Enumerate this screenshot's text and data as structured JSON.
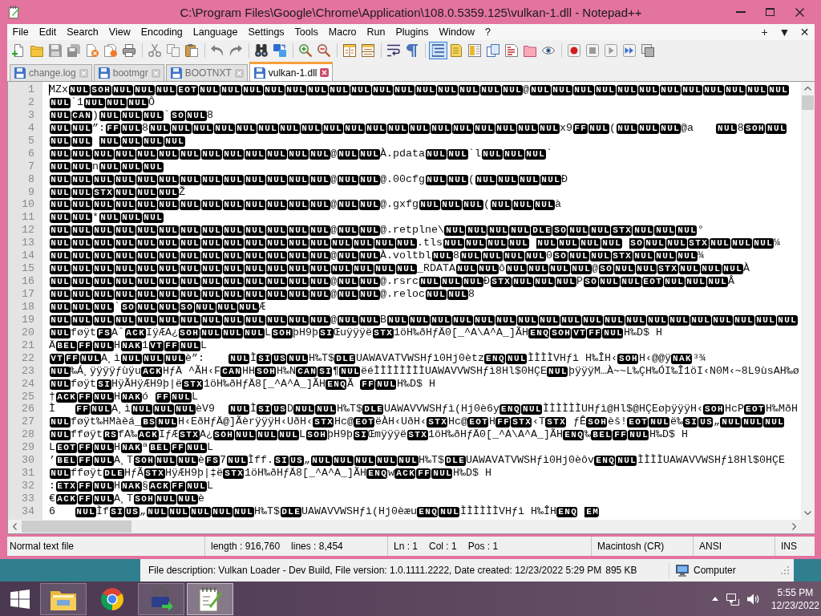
{
  "window": {
    "title": "C:\\Program Files\\Google\\Chrome\\Application\\108.0.5359.125\\vulkan-1.dll - Notepad++"
  },
  "menu": {
    "items": [
      "File",
      "Edit",
      "Search",
      "View",
      "Encoding",
      "Language",
      "Settings",
      "Tools",
      "Macro",
      "Run",
      "Plugins",
      "Window",
      "?"
    ],
    "right": [
      "+",
      "▼",
      "✕"
    ]
  },
  "toolbar": [
    {
      "buttons": [
        {
          "pressed": false
        },
        {
          "pressed": false
        },
        {
          "pressed": false
        },
        {
          "pressed": false
        },
        {
          "pressed": false
        },
        {
          "pressed": false
        },
        {
          "pressed": false
        }
      ]
    },
    {
      "buttons": [
        {
          "pressed": false
        },
        {
          "pressed": false
        },
        {
          "pressed": false
        }
      ]
    },
    {
      "buttons": [
        {
          "pressed": false
        },
        {
          "pressed": false
        }
      ]
    },
    {
      "buttons": [
        {
          "pressed": false
        },
        {
          "pressed": false
        }
      ]
    },
    {
      "buttons": [
        {
          "pressed": false
        },
        {
          "pressed": false
        }
      ]
    },
    {
      "buttons": [
        {
          "pressed": false
        },
        {
          "pressed": false
        }
      ]
    },
    {
      "buttons": [
        {
          "pressed": false
        },
        {
          "pressed": false
        }
      ]
    },
    {
      "buttons": [
        {
          "pressed": true
        },
        {
          "pressed": false
        },
        {
          "pressed": false
        },
        {
          "pressed": false
        },
        {
          "pressed": false
        },
        {
          "pressed": false
        },
        {
          "pressed": false
        }
      ]
    },
    {
      "buttons": [
        {
          "pressed": false
        },
        {
          "pressed": false
        },
        {
          "pressed": false
        },
        {
          "pressed": false
        },
        {
          "pressed": false
        }
      ]
    }
  ],
  "tabs": [
    {
      "label": "change.log",
      "selected": false
    },
    {
      "label": "bootmgr",
      "selected": false
    },
    {
      "label": "BOOTNXT",
      "selected": false
    },
    {
      "label": "vulkan-1.dll",
      "selected": true
    }
  ],
  "editor": {
    "lines": [
      {
        "number": "1",
        "runs": [
          "MZx",
          {
            "ctl": "NUL"
          },
          {
            "ctl": "SOH"
          },
          {
            "ctl": "NUL"
          },
          {
            "ctl": "NUL"
          },
          {
            "ctl": "NUL"
          },
          {
            "ctl": "EOT"
          },
          {
            "ctl": "NUL"
          },
          {
            "ctl": "NUL"
          },
          {
            "ctl": "NUL"
          },
          {
            "ctl": "NUL"
          },
          {
            "ctl": "NUL"
          },
          {
            "ctl": "NUL"
          },
          {
            "ctl": "NUL"
          },
          {
            "ctl": "NUL"
          },
          {
            "ctl": "NUL"
          },
          {
            "ctl": "NUL"
          },
          {
            "ctl": "NUL"
          },
          {
            "ctl": "NUL"
          },
          {
            "ctl": "NUL"
          },
          {
            "ctl": "NUL"
          },
          {
            "ctl": "NUL"
          },
          "@",
          {
            "ctl": "NUL"
          },
          {
            "ctl": "NUL"
          },
          {
            "ctl": "NUL"
          },
          {
            "ctl": "NUL"
          },
          {
            "ctl": "NUL"
          },
          {
            "ctl": "NUL"
          },
          {
            "ctl": "NUL"
          },
          {
            "ctl": "NUL"
          },
          {
            "ctl": "NUL"
          },
          {
            "ctl": "NUL"
          },
          {
            "ctl": "NUL"
          },
          {
            "ctl": "NUL"
          }
        ]
      },
      {
        "number": "2",
        "runs": [
          {
            "ctl": "NUL"
          },
          "`1",
          {
            "ctl": "NUL"
          },
          {
            "ctl": "NUL"
          },
          {
            "ctl": "NUL"
          },
          "Ô"
        ]
      },
      {
        "number": "3",
        "runs": [
          {
            "ctl": "NUL"
          },
          {
            "ctl": "CAN"
          },
          ")",
          {
            "ctl": "NUL"
          },
          {
            "ctl": "NUL"
          },
          {
            "ctl": "NUL"
          },
          "`",
          {
            "ctl": "SO"
          },
          {
            "ctl": "NUL"
          },
          "8"
        ]
      },
      {
        "number": "4",
        "runs": [
          {
            "ctl": "NUL"
          },
          {
            "ctl": "NUL"
          },
          "”:",
          {
            "ctl": "FF"
          },
          {
            "ctl": "NUL"
          },
          "8",
          {
            "ctl": "NUL"
          },
          {
            "ctl": "NUL"
          },
          {
            "ctl": "NUL"
          },
          {
            "ctl": "NUL"
          },
          {
            "ctl": "NUL"
          },
          {
            "ctl": "NUL"
          },
          {
            "ctl": "NUL"
          },
          {
            "ctl": "NUL"
          },
          {
            "ctl": "NUL"
          },
          {
            "ctl": "NUL"
          },
          {
            "ctl": "NUL"
          },
          {
            "ctl": "NUL"
          },
          {
            "ctl": "NUL"
          },
          {
            "ctl": "NUL"
          },
          {
            "ctl": "NUL"
          },
          {
            "ctl": "NUL"
          },
          {
            "ctl": "NUL"
          },
          {
            "ctl": "NUL"
          },
          {
            "ctl": "NUL"
          },
          "x9",
          {
            "ctl": "FF"
          },
          {
            "ctl": "NUL"
          },
          "(",
          {
            "ctl": "NUL"
          },
          {
            "ctl": "NUL"
          },
          {
            "ctl": "NUL"
          },
          "@a\t",
          {
            "ctl": "NUL"
          },
          "8",
          {
            "ctl": "SOH"
          },
          {
            "ctl": "NUL"
          }
        ]
      },
      {
        "number": "5",
        "runs": [
          {
            "ctl": "NUL"
          },
          {
            "ctl": "NUL"
          },
          {
            "ctl": "NUL",
            "spaced": true
          },
          {
            "ctl": "NUL"
          },
          {
            "ctl": "NUL"
          },
          {
            "ctl": "NUL"
          }
        ]
      },
      {
        "number": "6",
        "runs": [
          {
            "ctl": "NUL"
          },
          {
            "ctl": "NUL"
          },
          {
            "ctl": "NUL"
          },
          {
            "ctl": "NUL"
          },
          {
            "ctl": "NUL"
          },
          {
            "ctl": "NUL"
          },
          {
            "ctl": "NUL"
          },
          {
            "ctl": "NUL"
          },
          {
            "ctl": "NUL"
          },
          {
            "ctl": "NUL"
          },
          {
            "ctl": "NUL"
          },
          {
            "ctl": "NUL"
          },
          {
            "ctl": "NUL"
          },
          "@",
          {
            "ctl": "NUL"
          },
          {
            "ctl": "NUL"
          },
          "À.pdata",
          {
            "ctl": "NUL"
          },
          {
            "ctl": "NUL"
          },
          "`l",
          {
            "ctl": "NUL"
          },
          {
            "ctl": "NUL"
          },
          {
            "ctl": "NUL"
          },
          "`"
        ]
      },
      {
        "number": "7",
        "runs": [
          {
            "ctl": "NUL"
          },
          {
            "ctl": "NUL"
          },
          "n",
          {
            "ctl": "NUL"
          },
          {
            "ctl": "NUL"
          },
          {
            "ctl": "NUL"
          }
        ]
      },
      {
        "number": "8",
        "runs": [
          {
            "ctl": "NUL"
          },
          {
            "ctl": "NUL"
          },
          {
            "ctl": "NUL"
          },
          {
            "ctl": "NUL"
          },
          {
            "ctl": "NUL"
          },
          {
            "ctl": "NUL"
          },
          {
            "ctl": "NUL"
          },
          {
            "ctl": "NUL"
          },
          {
            "ctl": "NUL"
          },
          {
            "ctl": "NUL"
          },
          {
            "ctl": "NUL"
          },
          {
            "ctl": "NUL"
          },
          {
            "ctl": "NUL"
          },
          "@",
          {
            "ctl": "NUL"
          },
          {
            "ctl": "NUL"
          },
          "@.00cfg",
          {
            "ctl": "NUL"
          },
          {
            "ctl": "NUL"
          },
          "(",
          {
            "ctl": "NUL"
          },
          {
            "ctl": "NUL"
          },
          {
            "ctl": "NUL"
          },
          {
            "ctl": "NUL"
          },
          "Ð"
        ]
      },
      {
        "number": "9",
        "runs": [
          {
            "ctl": "NUL"
          },
          {
            "ctl": "NUL"
          },
          {
            "ctl": "STX"
          },
          {
            "ctl": "NUL"
          },
          {
            "ctl": "NUL"
          },
          {
            "ctl": "NUL"
          },
          "Ž"
        ]
      },
      {
        "number": "10",
        "runs": [
          {
            "ctl": "NUL"
          },
          {
            "ctl": "NUL"
          },
          {
            "ctl": "NUL"
          },
          {
            "ctl": "NUL"
          },
          {
            "ctl": "NUL"
          },
          {
            "ctl": "NUL"
          },
          {
            "ctl": "NUL"
          },
          {
            "ctl": "NUL"
          },
          {
            "ctl": "NUL"
          },
          {
            "ctl": "NUL"
          },
          {
            "ctl": "NUL"
          },
          {
            "ctl": "NUL"
          },
          {
            "ctl": "NUL"
          },
          "@",
          {
            "ctl": "NUL"
          },
          {
            "ctl": "NUL"
          },
          "@.gxfg",
          {
            "ctl": "NUL"
          },
          {
            "ctl": "NUL"
          },
          {
            "ctl": "NUL"
          },
          "(",
          {
            "ctl": "NUL"
          },
          {
            "ctl": "NUL"
          },
          {
            "ctl": "NUL"
          },
          "à"
        ]
      },
      {
        "number": "11",
        "runs": [
          {
            "ctl": "NUL"
          },
          {
            "ctl": "NUL"
          },
          "*",
          {
            "ctl": "NUL"
          },
          {
            "ctl": "NUL"
          },
          {
            "ctl": "NUL"
          }
        ]
      },
      {
        "number": "12",
        "runs": [
          {
            "ctl": "NUL"
          },
          {
            "ctl": "NUL"
          },
          {
            "ctl": "NUL"
          },
          {
            "ctl": "NUL"
          },
          {
            "ctl": "NUL"
          },
          {
            "ctl": "NUL"
          },
          {
            "ctl": "NUL"
          },
          {
            "ctl": "NUL"
          },
          {
            "ctl": "NUL"
          },
          {
            "ctl": "NUL"
          },
          {
            "ctl": "NUL"
          },
          {
            "ctl": "NUL"
          },
          {
            "ctl": "NUL"
          },
          "@",
          {
            "ctl": "NUL"
          },
          {
            "ctl": "NUL"
          },
          "@.retplne\\",
          {
            "ctl": "NUL"
          },
          {
            "ctl": "NUL"
          },
          {
            "ctl": "NUL"
          },
          {
            "ctl": "NUL"
          },
          {
            "ctl": "DLE"
          },
          {
            "ctl": "SO"
          },
          {
            "ctl": "NUL"
          },
          {
            "ctl": "NUL"
          },
          {
            "ctl": "STX"
          },
          {
            "ctl": "NUL"
          },
          {
            "ctl": "NUL"
          },
          {
            "ctl": "NUL"
          },
          "°"
        ]
      },
      {
        "number": "13",
        "runs": [
          {
            "ctl": "NUL"
          },
          {
            "ctl": "NUL"
          },
          {
            "ctl": "NUL"
          },
          {
            "ctl": "NUL"
          },
          {
            "ctl": "NUL"
          },
          {
            "ctl": "NUL"
          },
          {
            "ctl": "NUL"
          },
          {
            "ctl": "NUL"
          },
          {
            "ctl": "NUL"
          },
          {
            "ctl": "NUL"
          },
          {
            "ctl": "NUL"
          },
          {
            "ctl": "NUL"
          },
          {
            "ctl": "NUL"
          },
          {
            "ctl": "NUL"
          },
          {
            "ctl": "NUL"
          },
          {
            "ctl": "NUL"
          },
          {
            "ctl": "NUL"
          },
          ".tls",
          {
            "ctl": "NUL"
          },
          {
            "ctl": "NUL"
          },
          {
            "ctl": "NUL"
          },
          {
            "ctl": "NUL"
          },
          {
            "ctl": "NUL",
            "spaced": true
          },
          {
            "ctl": "NUL"
          },
          {
            "ctl": "NUL"
          },
          {
            "ctl": "NUL"
          },
          {
            "ctl": "SO",
            "spaced": true
          },
          {
            "ctl": "NUL"
          },
          {
            "ctl": "NUL"
          },
          {
            "ctl": "STX"
          },
          {
            "ctl": "NUL"
          },
          {
            "ctl": "NUL"
          },
          {
            "ctl": "NUL"
          },
          "¼"
        ]
      },
      {
        "number": "14",
        "runs": [
          {
            "ctl": "NUL"
          },
          {
            "ctl": "NUL"
          },
          {
            "ctl": "NUL"
          },
          {
            "ctl": "NUL"
          },
          {
            "ctl": "NUL"
          },
          {
            "ctl": "NUL"
          },
          {
            "ctl": "NUL"
          },
          {
            "ctl": "NUL"
          },
          {
            "ctl": "NUL"
          },
          {
            "ctl": "NUL"
          },
          {
            "ctl": "NUL"
          },
          {
            "ctl": "NUL"
          },
          {
            "ctl": "NUL"
          },
          "@",
          {
            "ctl": "NUL"
          },
          {
            "ctl": "NUL"
          },
          "À.voltbl",
          {
            "ctl": "NUL"
          },
          "8",
          {
            "ctl": "NUL"
          },
          {
            "ctl": "NUL"
          },
          {
            "ctl": "NUL"
          },
          {
            "ctl": "NUL"
          },
          "0",
          {
            "ctl": "SO"
          },
          {
            "ctl": "NUL"
          },
          {
            "ctl": "NUL"
          },
          {
            "ctl": "STX"
          },
          {
            "ctl": "NUL"
          },
          {
            "ctl": "NUL"
          },
          {
            "ctl": "NUL"
          },
          "¾"
        ]
      },
      {
        "number": "15",
        "runs": [
          {
            "ctl": "NUL"
          },
          {
            "ctl": "NUL"
          },
          {
            "ctl": "NUL"
          },
          {
            "ctl": "NUL"
          },
          {
            "ctl": "NUL"
          },
          {
            "ctl": "NUL"
          },
          {
            "ctl": "NUL"
          },
          {
            "ctl": "NUL"
          },
          {
            "ctl": "NUL"
          },
          {
            "ctl": "NUL"
          },
          {
            "ctl": "NUL"
          },
          {
            "ctl": "NUL"
          },
          {
            "ctl": "NUL"
          },
          {
            "ctl": "NUL"
          },
          {
            "ctl": "NUL"
          },
          {
            "ctl": "NUL"
          },
          {
            "ctl": "NUL"
          },
          "_RDATA",
          {
            "ctl": "NUL"
          },
          {
            "ctl": "NUL"
          },
          "ô",
          {
            "ctl": "NUL"
          },
          {
            "ctl": "NUL"
          },
          {
            "ctl": "NUL"
          },
          {
            "ctl": "NUL"
          },
          "@",
          {
            "ctl": "SO"
          },
          {
            "ctl": "NUL"
          },
          {
            "ctl": "NUL"
          },
          {
            "ctl": "STX"
          },
          {
            "ctl": "NUL"
          },
          {
            "ctl": "NUL"
          },
          {
            "ctl": "NUL"
          },
          "À"
        ]
      },
      {
        "number": "16",
        "runs": [
          {
            "ctl": "NUL"
          },
          {
            "ctl": "NUL"
          },
          {
            "ctl": "NUL"
          },
          {
            "ctl": "NUL"
          },
          {
            "ctl": "NUL"
          },
          {
            "ctl": "NUL"
          },
          {
            "ctl": "NUL"
          },
          {
            "ctl": "NUL"
          },
          {
            "ctl": "NUL"
          },
          {
            "ctl": "NUL"
          },
          {
            "ctl": "NUL"
          },
          {
            "ctl": "NUL"
          },
          {
            "ctl": "NUL"
          },
          "@",
          {
            "ctl": "NUL"
          },
          {
            "ctl": "NUL"
          },
          "@.rsrc",
          {
            "ctl": "NUL"
          },
          {
            "ctl": "NUL"
          },
          {
            "ctl": "NUL"
          },
          "Ð",
          {
            "ctl": "STX"
          },
          {
            "ctl": "NUL"
          },
          {
            "ctl": "NUL"
          },
          {
            "ctl": "NUL"
          },
          "P",
          {
            "ctl": "SO"
          },
          {
            "ctl": "NUL"
          },
          {
            "ctl": "NUL"
          },
          {
            "ctl": "EOT"
          },
          {
            "ctl": "NUL"
          },
          {
            "ctl": "NUL"
          },
          {
            "ctl": "NUL"
          },
          "Â"
        ]
      },
      {
        "number": "17",
        "runs": [
          {
            "ctl": "NUL"
          },
          {
            "ctl": "NUL"
          },
          {
            "ctl": "NUL"
          },
          {
            "ctl": "NUL"
          },
          {
            "ctl": "NUL"
          },
          {
            "ctl": "NUL"
          },
          {
            "ctl": "NUL"
          },
          {
            "ctl": "NUL"
          },
          {
            "ctl": "NUL"
          },
          {
            "ctl": "NUL"
          },
          {
            "ctl": "NUL"
          },
          {
            "ctl": "NUL"
          },
          {
            "ctl": "NUL"
          },
          "@",
          {
            "ctl": "NUL"
          },
          {
            "ctl": "NUL"
          },
          "@.reloc",
          {
            "ctl": "NUL"
          },
          {
            "ctl": "NUL"
          },
          "8"
        ]
      },
      {
        "number": "18",
        "runs": [
          {
            "ctl": "NUL"
          },
          {
            "ctl": "NUL"
          },
          {
            "ctl": "NUL"
          },
          "`",
          {
            "ctl": "SO"
          },
          {
            "ctl": "NUL"
          },
          {
            "ctl": "NUL"
          },
          {
            "ctl": "SO"
          },
          {
            "ctl": "NUL"
          },
          {
            "ctl": "NUL"
          },
          {
            "ctl": "NUL"
          },
          "Æ"
        ]
      },
      {
        "number": "19",
        "runs": [
          {
            "ctl": "NUL"
          },
          {
            "ctl": "NUL"
          },
          {
            "ctl": "NUL"
          },
          {
            "ctl": "NUL"
          },
          {
            "ctl": "NUL"
          },
          {
            "ctl": "NUL"
          },
          {
            "ctl": "NUL"
          },
          {
            "ctl": "NUL"
          },
          {
            "ctl": "NUL"
          },
          {
            "ctl": "NUL"
          },
          {
            "ctl": "NUL"
          },
          {
            "ctl": "NUL"
          },
          {
            "ctl": "NUL"
          },
          "@",
          {
            "ctl": "NUL"
          },
          {
            "ctl": "NUL"
          },
          "B",
          {
            "ctl": "NUL"
          },
          {
            "ctl": "NUL"
          },
          {
            "ctl": "NUL"
          },
          {
            "ctl": "NUL"
          },
          {
            "ctl": "NUL"
          },
          {
            "ctl": "NUL"
          },
          {
            "ctl": "NUL"
          },
          {
            "ctl": "NUL"
          },
          {
            "ctl": "NUL"
          },
          {
            "ctl": "NUL"
          },
          {
            "ctl": "NUL"
          },
          {
            "ctl": "NUL"
          },
          {
            "ctl": "NUL"
          },
          {
            "ctl": "NUL"
          },
          {
            "ctl": "NUL"
          },
          {
            "ctl": "NUL"
          },
          {
            "ctl": "NUL"
          },
          {
            "ctl": "NUL"
          },
          {
            "ctl": "NUL"
          }
        ]
      },
      {
        "number": "20",
        "runs": [
          {
            "ctl": "NUL"
          },
          "føÿt",
          {
            "ctl": "FS"
          },
          "Aˆ",
          {
            "ctl": "ACK"
          },
          "IÿÆA¿",
          {
            "ctl": "SOH"
          },
          {
            "ctl": "NUL"
          },
          {
            "ctl": "NUL"
          },
          {
            "ctl": "NUL"
          },
          "L",
          {
            "ctl": "SOH"
          },
          "þH9þ",
          {
            "ctl": "SI"
          },
          "Œuÿÿÿë",
          {
            "ctl": "STX"
          },
          "1öH‰ðHƒÄ0[_^A\\A^A_]ÃH",
          {
            "ctl": "ENQ"
          },
          {
            "ctl": "SOH"
          },
          {
            "ctl": "VT"
          },
          {
            "ctl": "FF"
          },
          {
            "ctl": "NUL"
          },
          "H‰D$ H"
        ]
      },
      {
        "number": "21",
        "runs": [
          "Ä",
          {
            "ctl": "BEL"
          },
          {
            "ctl": "FF"
          },
          {
            "ctl": "NUL"
          },
          "H",
          {
            "ctl": "NAK"
          },
          "1",
          {
            "ctl": "VT"
          },
          {
            "ctl": "FF"
          },
          {
            "ctl": "NUL"
          },
          "L"
        ]
      },
      {
        "number": "22",
        "runs": [
          {
            "ctl": "VT"
          },
          {
            "ctl": "FF"
          },
          {
            "ctl": "NUL"
          },
          "A¸ì",
          {
            "ctl": "NUL"
          },
          {
            "ctl": "NUL"
          },
          {
            "ctl": "NUL"
          },
          "è”:\t",
          {
            "ctl": "NUL"
          },
          "Ì",
          {
            "ctl": "SI"
          },
          {
            "ctl": "US"
          },
          {
            "ctl": "NUL"
          },
          "H‰T$",
          {
            "ctl": "DLE"
          },
          "UAWAVATVWSHƒì0Hj0ètz",
          {
            "ctl": "ENQ"
          },
          {
            "ctl": "NUL"
          },
          "ÌÌÌÌVHƒì H‰ÎH‹",
          {
            "ctl": "SOH"
          },
          "H‹@@ÿ",
          {
            "ctl": "NAK"
          },
          "³¾"
        ]
      },
      {
        "number": "23",
        "runs": [
          {
            "ctl": "NUL"
          },
          "‰Á¸ÿÿÿÿƒùÿu",
          {
            "ctl": "ACK"
          },
          "HƒÄ ^ÃH‹F",
          {
            "ctl": "CAN"
          },
          "HH",
          {
            "ctl": "SOH"
          },
          "H‰N",
          {
            "ctl": "CAN"
          },
          {
            "ctl": "SI"
          },
          "¶",
          {
            "ctl": "NUL"
          },
          "ëéÌÌÌÌÌÌÌÌUAWAVVWSHƒì8Hl$0HÇE",
          {
            "ctl": "NUL"
          },
          "þÿÿÿM…À~~L‰ÇH‰ÓI‰Î1öI‹N0M‹~8L9ùsAH‰ø"
        ]
      },
      {
        "number": "24",
        "runs": [
          {
            "ctl": "NUL"
          },
          "føÿt",
          {
            "ctl": "SI"
          },
          "HÿÃHÿÆH9þ|ë",
          {
            "ctl": "STX"
          },
          "1öH‰ðHƒÄ8[_^A^A_]ÃH",
          {
            "ctl": "ENQ"
          },
          "Ã ",
          {
            "ctl": "FF"
          },
          {
            "ctl": "NUL"
          },
          "H‰D$ H"
        ]
      },
      {
        "number": "25",
        "runs": [
          "†",
          {
            "ctl": "ACK"
          },
          {
            "ctl": "FF"
          },
          {
            "ctl": "NUL"
          },
          "H",
          {
            "ctl": "NAK"
          },
          "ó ",
          {
            "ctl": "FF"
          },
          {
            "ctl": "NUL"
          },
          "L"
        ]
      },
      {
        "number": "26",
        "runs": [
          "Ì\t",
          {
            "ctl": "FF"
          },
          {
            "ctl": "NUL"
          },
          "A¸ì",
          {
            "ctl": "NUL"
          },
          {
            "ctl": "NUL"
          },
          {
            "ctl": "NUL"
          },
          "èV9\t",
          {
            "ctl": "NUL"
          },
          "Ì",
          {
            "ctl": "SI"
          },
          {
            "ctl": "US"
          },
          "D",
          {
            "ctl": "NUL"
          },
          {
            "ctl": "NUL"
          },
          "H‰T$",
          {
            "ctl": "DLE"
          },
          "UAWAVVWSHƒì(Hj0è6y",
          {
            "ctl": "ENQ"
          },
          {
            "ctl": "NUL"
          },
          "ÌÌÌÌÌÌUHƒì@Hl$@HÇEøþÿÿÿH‹",
          {
            "ctl": "SOH"
          },
          "HcP",
          {
            "ctl": "EOT"
          },
          "H‰MðH"
        ]
      },
      {
        "number": "27",
        "runs": [
          {
            "ctl": "NUL"
          },
          "føÿt‰HMàèá_",
          {
            "ctl": "BS"
          },
          {
            "ctl": "NUL"
          },
          "H‹EðHƒÄ@]ÃèrÿÿÿH‹UðH‹",
          {
            "ctl": "STX"
          },
          "Hc@",
          {
            "ctl": "EOT"
          },
          "ëÀH‹UðH‹",
          {
            "ctl": "STX"
          },
          "Hc@",
          {
            "ctl": "EOT"
          },
          "H",
          {
            "ctl": "FF"
          },
          {
            "ctl": "STX"
          },
          "‹T",
          {
            "ctl": "STX"
          },
          " ƒÊ",
          {
            "ctl": "SOH"
          },
          "èš!",
          {
            "ctl": "EOT"
          },
          {
            "ctl": "NUL"
          },
          "ë‰",
          {
            "ctl": "SI"
          },
          {
            "ctl": "US"
          },
          "„",
          {
            "ctl": "NUL"
          },
          {
            "ctl": "NUL"
          },
          {
            "ctl": "NUL"
          }
        ]
      },
      {
        "number": "28",
        "runs": [
          {
            "ctl": "NUL"
          },
          "fføÿt",
          {
            "ctl": "RS"
          },
          "fA‰",
          {
            "ctl": "ACK"
          },
          "IƒÆ",
          {
            "ctl": "STX"
          },
          "A¿",
          {
            "ctl": "SOH"
          },
          {
            "ctl": "NUL"
          },
          {
            "ctl": "NUL"
          },
          {
            "ctl": "NUL"
          },
          "L",
          {
            "ctl": "SOH"
          },
          "þH9þ",
          {
            "ctl": "SI"
          },
          "Œmÿÿÿë",
          {
            "ctl": "STX"
          },
          "1öH‰ðHƒÄ0[_^A\\A^A_]ÃH",
          {
            "ctl": "ENQ"
          },
          "‰",
          {
            "ctl": "BEL"
          },
          {
            "ctl": "FF"
          },
          {
            "ctl": "NUL"
          },
          "H‰D$ H"
        ]
      },
      {
        "number": "29",
        "runs": [
          "L",
          {
            "ctl": "EOT"
          },
          {
            "ctl": "FF"
          },
          {
            "ctl": "NUL"
          },
          "H",
          {
            "ctl": "NAK"
          },
          "ª",
          {
            "ctl": "BEL"
          },
          {
            "ctl": "FF"
          },
          {
            "ctl": "NUL"
          },
          "L"
        ]
      },
      {
        "number": "30",
        "runs": [
          "’",
          {
            "ctl": "BEL"
          },
          {
            "ctl": "FF"
          },
          {
            "ctl": "NUL"
          },
          "A¸T",
          {
            "ctl": "SOH"
          },
          {
            "ctl": "NUL"
          },
          {
            "ctl": "NUL"
          },
          "è",
          {
            "ctl": "FS"
          },
          "7",
          {
            "ctl": "NUL"
          },
          "Ìff.",
          {
            "ctl": "SI"
          },
          {
            "ctl": "US"
          },
          "„",
          {
            "ctl": "NUL"
          },
          {
            "ctl": "NUL"
          },
          {
            "ctl": "NUL"
          },
          {
            "ctl": "NUL"
          },
          {
            "ctl": "NUL"
          },
          "H‰T$",
          {
            "ctl": "DLE"
          },
          "UAWAVATVWSHƒì0Hj0èôv",
          {
            "ctl": "ENQ"
          },
          {
            "ctl": "NUL"
          },
          "ÌÌÌÌUAWAVVWSHƒì8Hl$0HÇE"
        ]
      },
      {
        "number": "31",
        "runs": [
          {
            "ctl": "NUL"
          },
          "fføÿt",
          {
            "ctl": "DLE"
          },
          "HƒÃ",
          {
            "ctl": "STX"
          },
          "HÿÆH9þ|‡ë",
          {
            "ctl": "STX"
          },
          "1öH‰ðHƒÄ8[_^A^A_]ÃH",
          {
            "ctl": "ENQ"
          },
          "w",
          {
            "ctl": "ACK"
          },
          {
            "ctl": "FF"
          },
          {
            "ctl": "NUL"
          },
          "H‰D$ H"
        ]
      },
      {
        "number": "32",
        "runs": [
          ":",
          {
            "ctl": "ETX"
          },
          {
            "ctl": "FF"
          },
          {
            "ctl": "NUL"
          },
          "H",
          {
            "ctl": "NAK"
          },
          "§",
          {
            "ctl": "ACK"
          },
          {
            "ctl": "FF"
          },
          {
            "ctl": "NUL"
          },
          "L"
        ]
      },
      {
        "number": "33",
        "runs": [
          "€",
          {
            "ctl": "ACK"
          },
          {
            "ctl": "FF"
          },
          {
            "ctl": "NUL"
          },
          "A¸T",
          {
            "ctl": "SOH"
          },
          {
            "ctl": "NUL"
          },
          {
            "ctl": "NUL"
          },
          "è"
        ]
      },
      {
        "number": "34",
        "runs": [
          "6\t",
          {
            "ctl": "NUL"
          },
          "Ìf",
          {
            "ctl": "SI"
          },
          {
            "ctl": "US"
          },
          "„",
          {
            "ctl": "NUL"
          },
          {
            "ctl": "NUL"
          },
          {
            "ctl": "NUL"
          },
          {
            "ctl": "NUL"
          },
          {
            "ctl": "NUL"
          },
          "H‰T$",
          {
            "ctl": "DLE"
          },
          "UAWAVVWSHƒì(Hj0èæu",
          {
            "ctl": "ENQ"
          },
          {
            "ctl": "NUL"
          },
          "ÌÌÌÌÌÌVHƒì H‰ÎH",
          {
            "ctl": "ENQ"
          },
          {
            "ctl": "EM",
            "spaced": true
          }
        ]
      }
    ]
  },
  "status_bar": {
    "sections": [
      {
        "items": [
          "Normal text file"
        ]
      },
      {
        "items": [
          "length : 916,760",
          "lines : 8,454"
        ]
      },
      {
        "items": [
          "Ln : 1",
          "Col : 1",
          "Pos : 1"
        ]
      },
      {
        "items": [
          "Macintosh (CR)"
        ]
      },
      {
        "items": [
          "ANSI"
        ]
      },
      {
        "items": [
          "INS"
        ]
      }
    ]
  },
  "explorer_status": {
    "details": "File description: Vulkan Loader - Dev Build, File version: 1.0.1111.2222, Date created: 12/23/2022 5:29 PM",
    "size": "895 KB",
    "location": "Computer"
  },
  "taskbar": {
    "apps": [
      {
        "running": true,
        "active": false
      },
      {
        "running": false,
        "active": false
      },
      {
        "running": true,
        "active": false
      },
      {
        "running": true,
        "active": true
      }
    ],
    "clock": {
      "time": "5:55 PM",
      "date": "12/23/2022"
    }
  }
}
